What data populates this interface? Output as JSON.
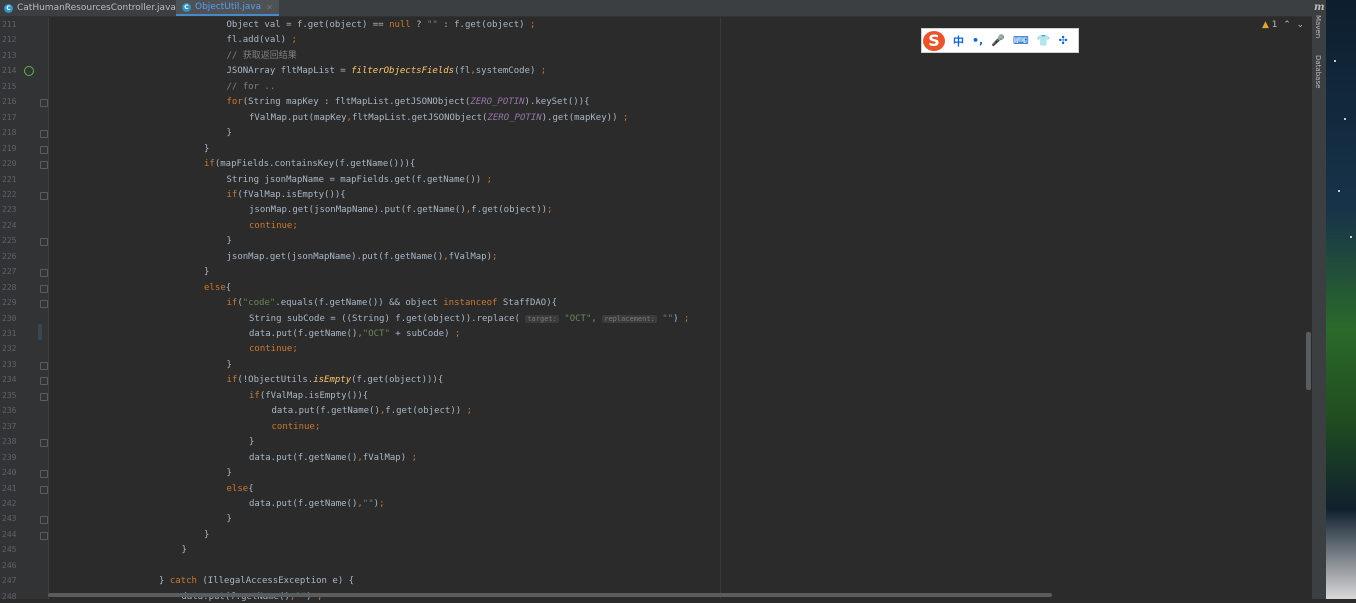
{
  "tabs": [
    {
      "label": "CatHumanResourcesController.java",
      "active": false
    },
    {
      "label": "ObjectUtil.java",
      "active": true
    }
  ],
  "editor": {
    "lines": [
      {
        "num": "211",
        "indent": 8,
        "parts": [
          [
            "p",
            "Object val = f.get(object) == "
          ],
          [
            "k",
            "null"
          ],
          [
            "p",
            " ? "
          ],
          [
            "s",
            "\"\""
          ],
          [
            "p",
            " : f.get(object) "
          ],
          [
            "k",
            ";"
          ]
        ]
      },
      {
        "num": "212",
        "indent": 8,
        "parts": [
          [
            "p",
            "fl.add(val) "
          ],
          [
            "k",
            ";"
          ]
        ]
      },
      {
        "num": "213",
        "indent": 8,
        "parts": [
          [
            "c",
            "// 获取返回结果"
          ]
        ]
      },
      {
        "num": "214",
        "indent": 8,
        "parts": [
          [
            "p",
            "JSONArray fltMapList = "
          ],
          [
            "f",
            "filterObjectsFields"
          ],
          [
            "p",
            "(fl"
          ],
          [
            "k",
            ","
          ],
          [
            "p",
            "systemCode) "
          ],
          [
            "k",
            ";"
          ]
        ]
      },
      {
        "num": "215",
        "indent": 8,
        "parts": [
          [
            "c",
            "// for .."
          ]
        ]
      },
      {
        "num": "216",
        "indent": 8,
        "parts": [
          [
            "k",
            "for"
          ],
          [
            "p",
            "(String mapKey : fltMapList.getJSONObject("
          ],
          [
            "i",
            "ZERO_POTIN"
          ],
          [
            "p",
            ").keySet()){"
          ]
        ]
      },
      {
        "num": "217",
        "indent": 10,
        "parts": [
          [
            "p",
            "fValMap.put(mapKey"
          ],
          [
            "k",
            ","
          ],
          [
            "p",
            "fltMapList.getJSONObject("
          ],
          [
            "i",
            "ZERO_POTIN"
          ],
          [
            "p",
            ").get(mapKey)) "
          ],
          [
            "k",
            ";"
          ]
        ]
      },
      {
        "num": "218",
        "indent": 8,
        "parts": [
          [
            "p",
            "}"
          ]
        ]
      },
      {
        "num": "219",
        "indent": 6,
        "parts": [
          [
            "p",
            "}"
          ]
        ]
      },
      {
        "num": "220",
        "indent": 6,
        "parts": [
          [
            "k",
            "if"
          ],
          [
            "p",
            "(mapFields.containsKey(f.getName())){"
          ]
        ]
      },
      {
        "num": "221",
        "indent": 8,
        "parts": [
          [
            "p",
            "String jsonMapName = mapFields.get(f.getName()) "
          ],
          [
            "k",
            ";"
          ]
        ]
      },
      {
        "num": "222",
        "indent": 8,
        "parts": [
          [
            "k",
            "if"
          ],
          [
            "p",
            "(fValMap.isEmpty()){"
          ]
        ]
      },
      {
        "num": "223",
        "indent": 10,
        "parts": [
          [
            "p",
            "jsonMap.get(jsonMapName).put(f.getName()"
          ],
          [
            "k",
            ","
          ],
          [
            "p",
            "f.get(object))"
          ],
          [
            "k",
            ";"
          ]
        ]
      },
      {
        "num": "224",
        "indent": 10,
        "parts": [
          [
            "k",
            "continue;"
          ]
        ]
      },
      {
        "num": "225",
        "indent": 8,
        "parts": [
          [
            "p",
            "}"
          ]
        ]
      },
      {
        "num": "226",
        "indent": 8,
        "parts": [
          [
            "p",
            "jsonMap.get(jsonMapName).put(f.getName()"
          ],
          [
            "k",
            ","
          ],
          [
            "p",
            "fValMap)"
          ],
          [
            "k",
            ";"
          ]
        ]
      },
      {
        "num": "227",
        "indent": 6,
        "parts": [
          [
            "p",
            "}"
          ]
        ]
      },
      {
        "num": "228",
        "indent": 6,
        "parts": [
          [
            "k",
            "else"
          ],
          [
            "p",
            "{"
          ]
        ]
      },
      {
        "num": "229",
        "indent": 8,
        "parts": [
          [
            "k",
            "if"
          ],
          [
            "p",
            "("
          ],
          [
            "s",
            "\"code\""
          ],
          [
            "p",
            ".equals(f.getName()) && object "
          ],
          [
            "k",
            "instanceof"
          ],
          [
            "p",
            " StaffDAO){"
          ]
        ]
      },
      {
        "num": "230",
        "indent": 10,
        "parts": [
          [
            "p",
            "String subCode = ((String) f.get(object)).replace( "
          ],
          [
            "h",
            "target:"
          ],
          [
            "p",
            " "
          ],
          [
            "s",
            "\"OCT\""
          ],
          [
            "k",
            ","
          ],
          [
            "p",
            " "
          ],
          [
            "h",
            "replacement:"
          ],
          [
            "p",
            " "
          ],
          [
            "s",
            "\"\""
          ],
          [
            "p",
            ") "
          ],
          [
            "k",
            ";"
          ]
        ]
      },
      {
        "num": "231",
        "indent": 10,
        "parts": [
          [
            "p",
            "data.put(f.getName()"
          ],
          [
            "k",
            ","
          ],
          [
            "s",
            "\"OCT\""
          ],
          [
            "p",
            " + subCode) "
          ],
          [
            "k",
            ";"
          ]
        ]
      },
      {
        "num": "232",
        "indent": 10,
        "parts": [
          [
            "k",
            "continue;"
          ]
        ]
      },
      {
        "num": "233",
        "indent": 8,
        "parts": [
          [
            "p",
            "}"
          ]
        ]
      },
      {
        "num": "234",
        "indent": 8,
        "parts": [
          [
            "k",
            "if"
          ],
          [
            "p",
            "(!ObjectUtils."
          ],
          [
            "f",
            "isEmpty"
          ],
          [
            "p",
            "(f.get(object))){"
          ]
        ]
      },
      {
        "num": "235",
        "indent": 10,
        "parts": [
          [
            "k",
            "if"
          ],
          [
            "p",
            "(fValMap.isEmpty()){"
          ]
        ]
      },
      {
        "num": "236",
        "indent": 12,
        "parts": [
          [
            "p",
            "data.put(f.getName()"
          ],
          [
            "k",
            ","
          ],
          [
            "p",
            "f.get(object)) "
          ],
          [
            "k",
            ";"
          ]
        ]
      },
      {
        "num": "237",
        "indent": 12,
        "parts": [
          [
            "k",
            "continue;"
          ]
        ]
      },
      {
        "num": "238",
        "indent": 10,
        "parts": [
          [
            "p",
            "}"
          ]
        ]
      },
      {
        "num": "239",
        "indent": 10,
        "parts": [
          [
            "p",
            "data.put(f.getName()"
          ],
          [
            "k",
            ","
          ],
          [
            "p",
            "fValMap) "
          ],
          [
            "k",
            ";"
          ]
        ]
      },
      {
        "num": "240",
        "indent": 8,
        "parts": [
          [
            "p",
            "}"
          ]
        ]
      },
      {
        "num": "241",
        "indent": 8,
        "parts": [
          [
            "k",
            "else"
          ],
          [
            "p",
            "{"
          ]
        ]
      },
      {
        "num": "242",
        "indent": 10,
        "parts": [
          [
            "p",
            "data.put(f.getName()"
          ],
          [
            "k",
            ","
          ],
          [
            "s",
            "\"\""
          ],
          [
            "p",
            ")"
          ],
          [
            "k",
            ";"
          ]
        ]
      },
      {
        "num": "243",
        "indent": 8,
        "parts": [
          [
            "p",
            "}"
          ]
        ]
      },
      {
        "num": "244",
        "indent": 6,
        "parts": [
          [
            "p",
            "}"
          ]
        ]
      },
      {
        "num": "245",
        "indent": 4,
        "parts": [
          [
            "p",
            "}"
          ]
        ]
      },
      {
        "num": "246",
        "indent": 0,
        "parts": []
      },
      {
        "num": "247",
        "indent": 2,
        "parts": [
          [
            "p",
            "} "
          ],
          [
            "k",
            "catch"
          ],
          [
            "p",
            " (IllegalAccessException e) {"
          ]
        ]
      },
      {
        "num": "248",
        "indent": 4,
        "parts": [
          [
            "p",
            "data.put(f.getName()"
          ],
          [
            "k",
            ","
          ],
          [
            "s",
            "\"\""
          ],
          [
            "p",
            ") "
          ],
          [
            "k",
            ";"
          ]
        ]
      }
    ]
  },
  "ime": {
    "logo": "S",
    "items": [
      "中",
      "•,",
      "🎤",
      "⌨",
      "👕",
      "✣"
    ]
  },
  "inspections": {
    "count": "1"
  },
  "sidebar": {
    "maven_label": "Maven",
    "database_label": "Database",
    "maven_icon": "m"
  }
}
